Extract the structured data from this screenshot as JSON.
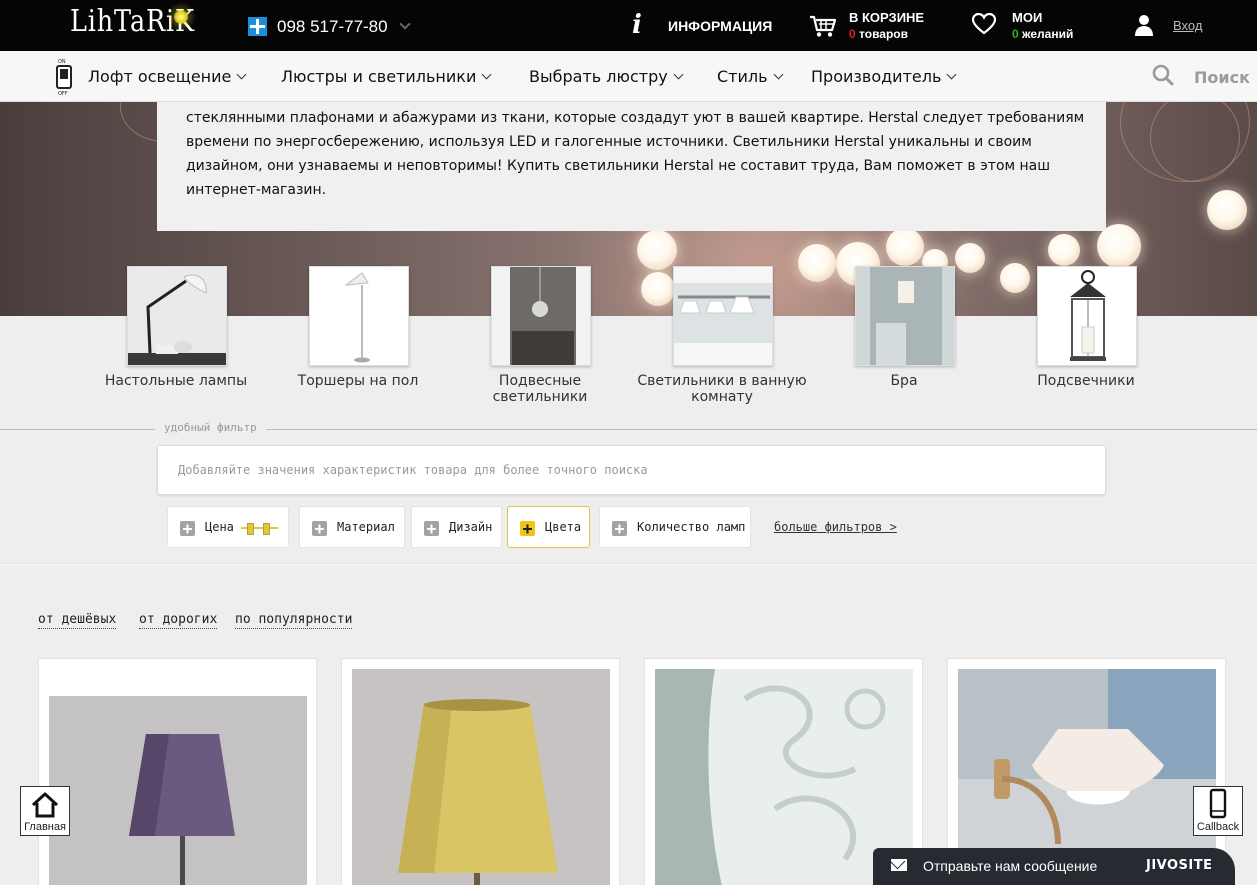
{
  "header": {
    "logo_text": "LihTaRiK",
    "phone": "098 517-77-80",
    "info_label": "ИНФОРМАЦИЯ",
    "cart": {
      "line1": "В КОРЗИНЕ",
      "count": "0",
      "unit": "товаров"
    },
    "wishlist": {
      "line1": "МОИ",
      "count": "0",
      "unit": "желаний"
    },
    "login_label": "Вход"
  },
  "nav": {
    "items": [
      {
        "label": "Лофт освещение"
      },
      {
        "label": "Люстры и светильники"
      },
      {
        "label": "Выбрать люстру"
      },
      {
        "label": "Стиль"
      },
      {
        "label": "Производитель"
      }
    ],
    "search_label": "Поиск"
  },
  "hero": {
    "text": "стеклянными плафонами и абажурами из ткани, которые создадут уют в вашей квартире. Herstal следует требованиям времени по энергосбережению, используя LED и галогенные источники.  Светильники Herstal уникальны и своим дизайном, они узнаваемы и неповторимы! Купить светильники Herstal не составит труда, Вам поможет в этом наш интернет-магазин."
  },
  "categories": [
    {
      "label": "Настольные лампы"
    },
    {
      "label": "Торшеры на пол"
    },
    {
      "label": "Подвесные светильники"
    },
    {
      "label": "Светильники в ванную комнату"
    },
    {
      "label": "Бра"
    },
    {
      "label": "Подсвечники"
    }
  ],
  "filter": {
    "caption": "удобный фильтр",
    "placeholder": "Добавляйте значения характеристик товара для более точного поиска",
    "chips": [
      {
        "label": "Цена",
        "active": false
      },
      {
        "label": "Материал",
        "active": false
      },
      {
        "label": "Дизайн",
        "active": false
      },
      {
        "label": "Цвета",
        "active": true
      },
      {
        "label": "Количество ламп",
        "active": false
      }
    ],
    "more_label": "больше фильтров >"
  },
  "sort": {
    "options": [
      {
        "label": "от дешёвых"
      },
      {
        "label": "от дорогих"
      },
      {
        "label": "по популярности"
      }
    ]
  },
  "floating": {
    "home_label": "Главная",
    "callback_label": "Callback",
    "chat_text": "Отправьте нам сообщение",
    "chat_brand": "JIVOSITE"
  },
  "colors": {
    "accent_yellow": "#f0c418",
    "cart_count_red": "#e0221b",
    "wish_count_green": "#2bb32b",
    "chat_bg": "#262b32"
  }
}
